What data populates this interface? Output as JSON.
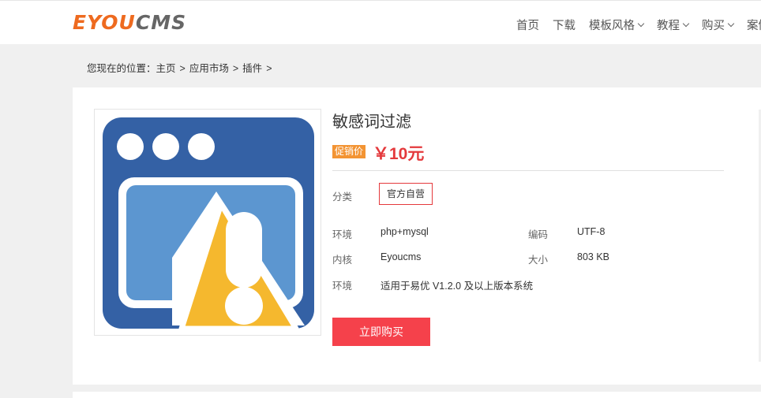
{
  "brand": {
    "logo_part1": "EYOU",
    "logo_part2": "CMS",
    "color_orange": "#ee6a1f",
    "color_gray": "#666666"
  },
  "nav": {
    "items": [
      {
        "label": "首页",
        "has_dropdown": false
      },
      {
        "label": "下载",
        "has_dropdown": false
      },
      {
        "label": "模板风格",
        "has_dropdown": true
      },
      {
        "label": "教程",
        "has_dropdown": true
      },
      {
        "label": "购买",
        "has_dropdown": true
      },
      {
        "label": "案例",
        "has_dropdown": false
      }
    ]
  },
  "breadcrumb": {
    "prefix": "您现在的位置：",
    "items": [
      "主页",
      "应用市场",
      "插件"
    ],
    "separator": ">"
  },
  "product": {
    "title": "敏感词过滤",
    "promo_label": "促销价",
    "price": "￥10元",
    "category_label": "分类",
    "category_tag": "官方自营",
    "specs": [
      {
        "label": "环境",
        "value": "php+mysql"
      },
      {
        "label": "编码",
        "value": "UTF-8"
      },
      {
        "label": "内核",
        "value": "Eyoucms"
      },
      {
        "label": "大小",
        "value": "803 KB"
      },
      {
        "label": "环境",
        "value": "适用于易优 V1.2.0 及以上版本系统"
      }
    ],
    "buy_label": "立即购买",
    "icon": "warning-window-icon",
    "colors": {
      "price": "#e4393c",
      "promo_bg": "#f39433",
      "button": "#f5414b",
      "icon_blue": "#3461a5",
      "icon_light_blue": "#5c96d0",
      "icon_yellow": "#f5b82e"
    }
  }
}
